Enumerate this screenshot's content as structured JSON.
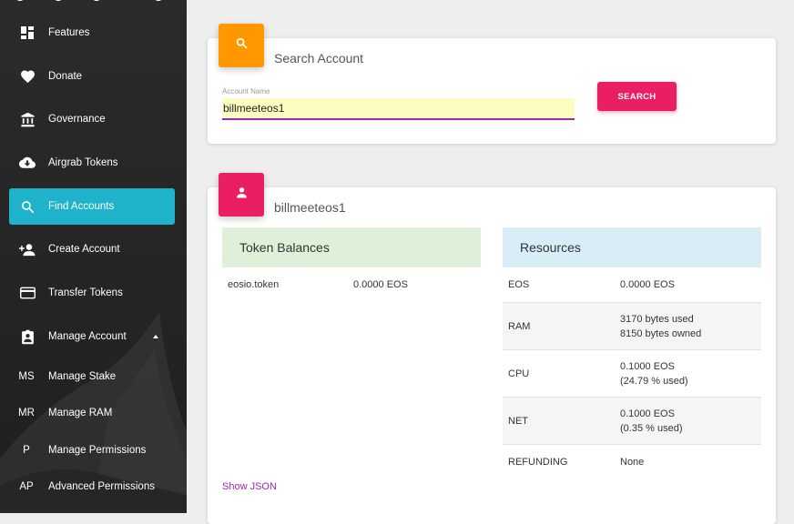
{
  "sidebar": {
    "items": [
      {
        "label": "Features",
        "icon": "dashboard-icon"
      },
      {
        "label": "Donate",
        "icon": "heart-icon"
      },
      {
        "label": "Governance",
        "icon": "bank-icon"
      },
      {
        "label": "Airgrab Tokens",
        "icon": "cloud-download-icon"
      },
      {
        "label": "Find Accounts",
        "icon": "search-icon",
        "active": true
      },
      {
        "label": "Create Account",
        "icon": "person-add-icon"
      },
      {
        "label": "Transfer Tokens",
        "icon": "credit-card-icon"
      },
      {
        "label": "Manage Account",
        "icon": "assignment-ind-icon"
      }
    ],
    "sub_items": [
      {
        "abbr": "MS",
        "label": "Manage Stake"
      },
      {
        "abbr": "MR",
        "label": "Manage RAM"
      },
      {
        "abbr": "P",
        "label": "Manage Permissions"
      },
      {
        "abbr": "AP",
        "label": "Advanced Permissions"
      }
    ]
  },
  "search": {
    "title": "Search Account",
    "field_label": "Account Name",
    "value": "billmeeteos1",
    "button": "SEARCH"
  },
  "account": {
    "name": "billmeeteos1",
    "token_balances": {
      "title": "Token Balances",
      "rows": [
        {
          "contract": "eosio.token",
          "balance": "0.0000 EOS"
        }
      ]
    },
    "resources": {
      "title": "Resources",
      "rows": [
        {
          "key": "EOS",
          "line1": "0.0000 EOS",
          "line2": ""
        },
        {
          "key": "RAM",
          "line1": "3170 bytes used",
          "line2": "8150 bytes owned"
        },
        {
          "key": "CPU",
          "line1": "0.1000 EOS",
          "line2": "(24.79 % used)"
        },
        {
          "key": "NET",
          "line1": "0.1000 EOS",
          "line2": "(0.35 % used)"
        },
        {
          "key": "REFUNDING",
          "line1": "None",
          "line2": ""
        }
      ]
    },
    "show_json": "Show JSON"
  },
  "colors": {
    "accent_active": "#1fb3cb",
    "search_icon_bg": "#ff9800",
    "account_icon_bg": "#e91e63",
    "button": "#e91e63",
    "token_head_bg": "#dff0d8",
    "resources_head_bg": "#d9edf7",
    "link": "#9c27b0"
  }
}
